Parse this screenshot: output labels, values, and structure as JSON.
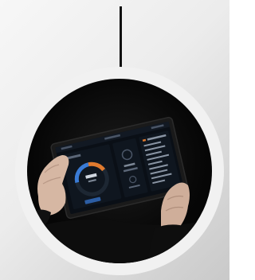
{
  "image": {
    "description_icon": "tablet-dashboard-photo",
    "colors": {
      "background_light": "#f7f7f7",
      "background_dark": "#c9c9c9",
      "ring": "#f1f1f1",
      "photo_bg": "#050505",
      "accent_blue": "#3a7bd5",
      "accent_orange": "#e07a2e"
    }
  }
}
